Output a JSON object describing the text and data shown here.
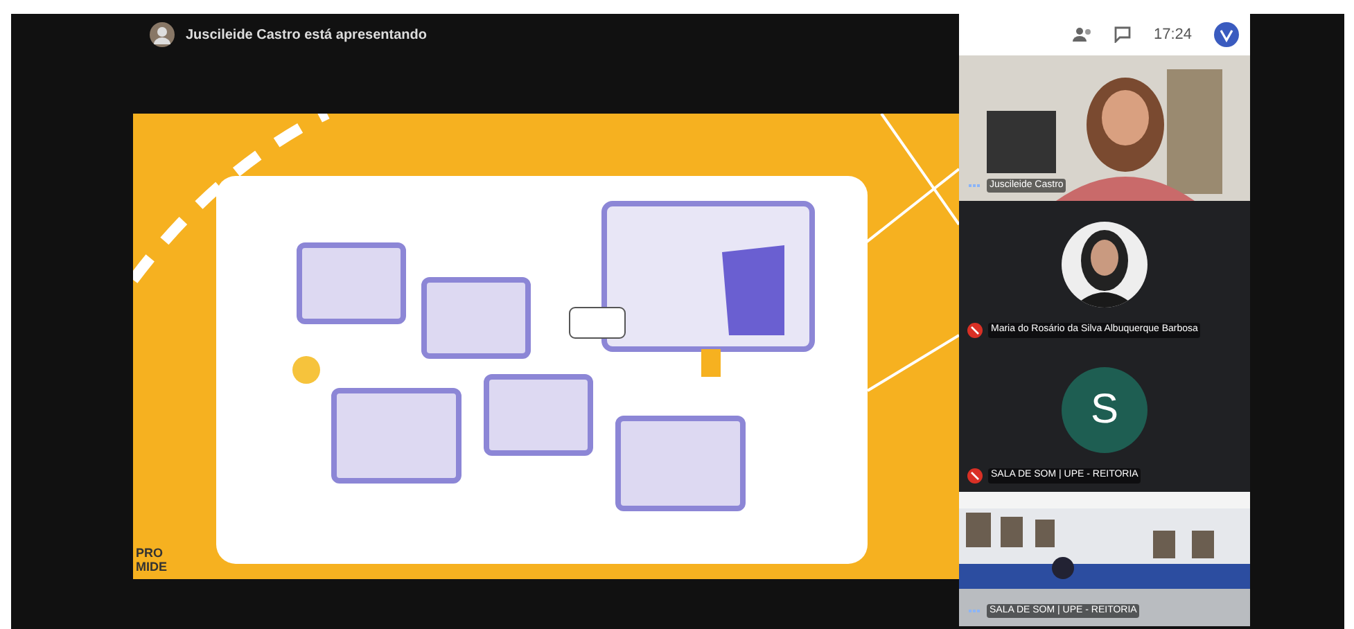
{
  "presenter_bar": {
    "text": "Juscileide Castro está apresentando"
  },
  "top_bar": {
    "time": "17:24"
  },
  "slide": {
    "kind": "picture",
    "logo": [
      "PRO",
      "MIDE"
    ]
  },
  "participants": [
    {
      "name": "Juscileide Castro",
      "kind": "video",
      "muted": false
    },
    {
      "name": "Maria do Rosário da Silva Albuquerque Barbosa",
      "muted": true
    },
    {
      "name": "SALA DE SOM | UPE - REITORIA",
      "kind": "initial",
      "initial": "S",
      "muted": true
    },
    {
      "name": "SALA DE SOM | UPE - REITORIA",
      "kind": "room",
      "muted": false
    }
  ]
}
